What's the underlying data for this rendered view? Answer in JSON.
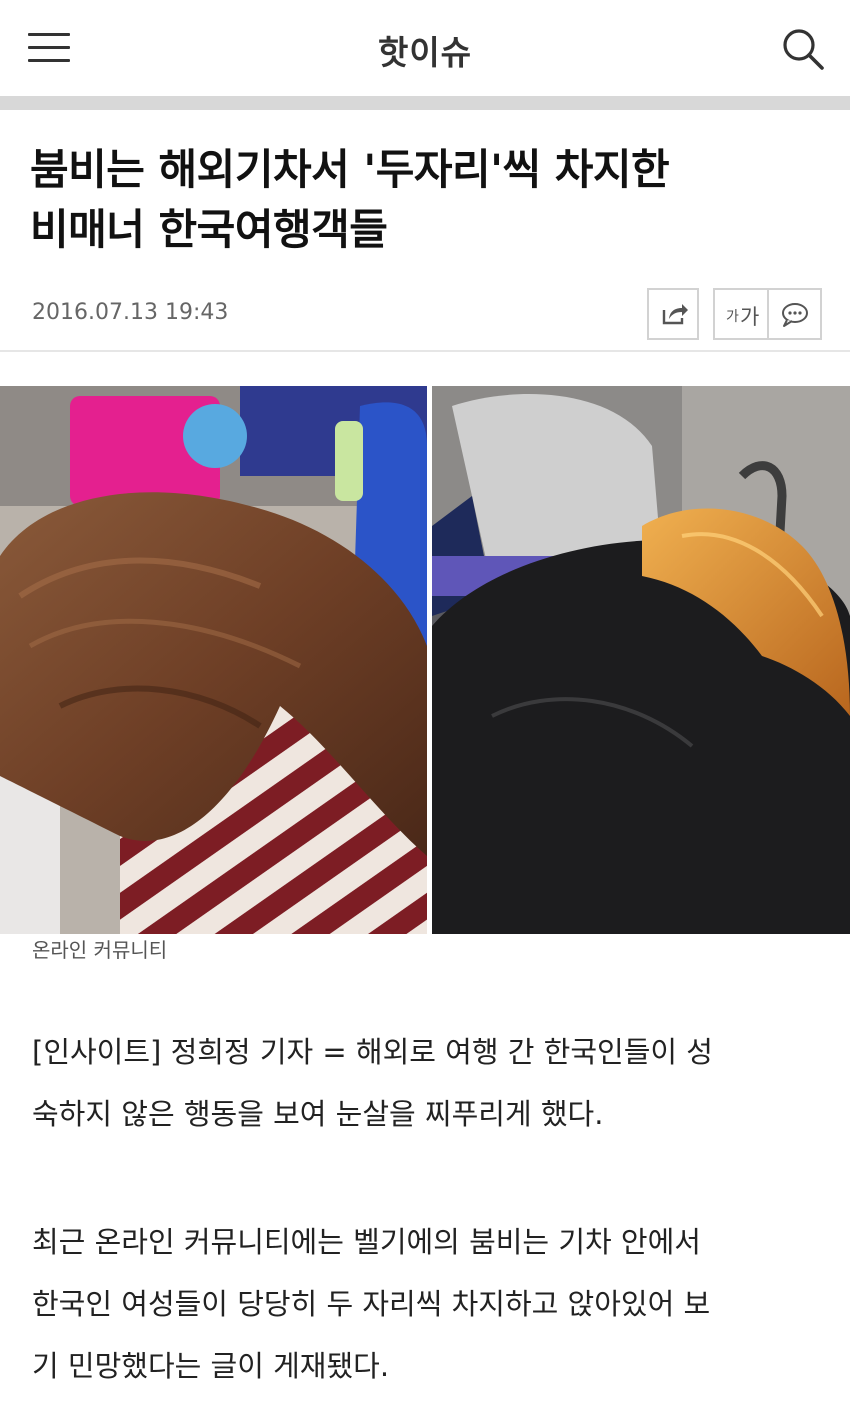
{
  "header": {
    "title": "핫이슈",
    "menu_icon": "hamburger-menu-icon",
    "search_icon": "search-icon"
  },
  "article": {
    "headline_line1": "붐비는 해외기차서 '두자리'씩 차지한",
    "headline_line2": "비매너 한국여행객들",
    "date": "2016.07.13 19:43",
    "tools": {
      "share_icon": "share-icon",
      "font_size_small": "가",
      "font_size_large": "가",
      "comment_icon": "comment-icon"
    },
    "photo_caption": "온라인 커뮤니티",
    "paragraphs": [
      {
        "line1": "[인사이트] 정희정 기자 = 해외로 여행 간 한국인들이 성",
        "line2": "숙하지 않은 행동을 보여 눈살을 찌푸리게 했다."
      },
      {
        "line1": "최근 온라인 커뮤니티에는 벨기에의 붐비는 기차 안에서",
        "line2": "한국인 여성들이 당당히 두 자리씩 차지하고 앉아있어 보",
        "line3": "기 민망했다는 글이 게재됐다."
      }
    ]
  },
  "colors": {
    "divider_band": "#d8d8d8",
    "text": "#222222",
    "meta_text": "#666666"
  }
}
